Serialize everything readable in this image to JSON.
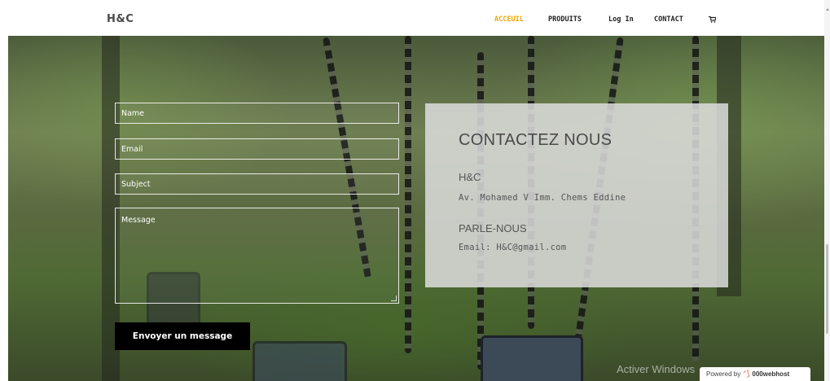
{
  "navbar": {
    "brand": "H&C",
    "items": [
      {
        "label": "ACCEUIL",
        "active": true
      },
      {
        "label": "PRODUITS",
        "active": false
      },
      {
        "label": "Log In",
        "active": false
      },
      {
        "label": "CONTACT",
        "active": false
      }
    ],
    "cart_icon": "cart-icon",
    "accent_color": "#f0a400"
  },
  "form": {
    "name_placeholder": "Name",
    "email_placeholder": "Email",
    "subject_placeholder": "Subject",
    "message_placeholder": "Message",
    "submit_label": "Envoyer un message"
  },
  "contact_panel": {
    "title": "CONTACTEZ NOUS",
    "company": "H&C",
    "address": "Av. Mohamed V Imm. Chems Eddine",
    "talk_heading": "PARLE-NOUS",
    "email": "Email: H&C@gmail.com"
  },
  "watermark": "Activer Windows",
  "hosting_badge": {
    "powered_by": "Powered by",
    "host": "000webhost"
  }
}
